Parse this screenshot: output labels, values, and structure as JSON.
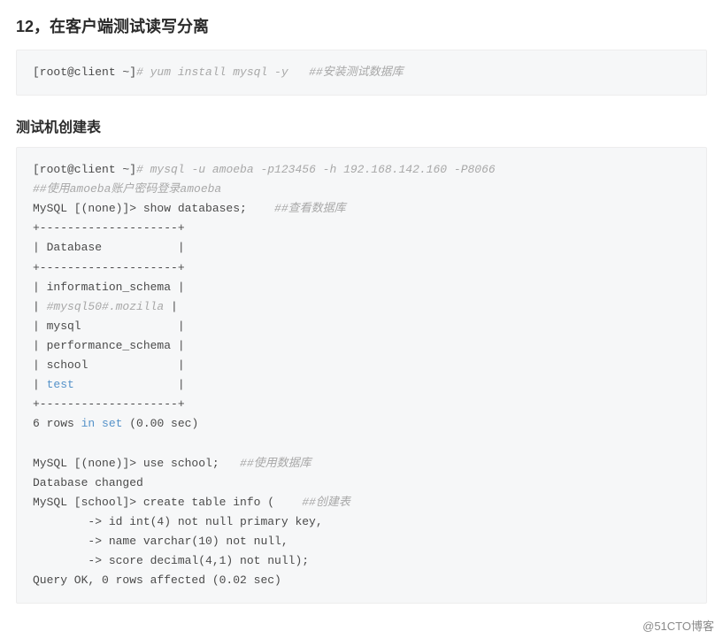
{
  "heading_main": "12，在客户端测试读写分离",
  "code1": {
    "prompt": "[root@client ~]",
    "cmd_comment": "# yum install mysql -y   ",
    "cn_comment": "##安装测试数据库"
  },
  "heading_sub": "测试机创建表",
  "code2": {
    "l1_prompt": "[root@client ~]",
    "l1_cmt": "# mysql -u amoeba -p123456 -h 192.168.142.160 -P8066",
    "l2_cmt": "##使用amoeba账户密码登录amoeba",
    "l3_a": "MySQL [(none)]> show databases;    ",
    "l3_cmt": "##查看数据库",
    "l4": "+--------------------+",
    "l5": "| Database           |",
    "l6": "+--------------------+",
    "l7": "| information_schema |",
    "l8_a": "| ",
    "l8_cmt": "#mysql50#.mozilla",
    "l8_b": " |",
    "l9": "| mysql              |",
    "l10": "| performance_schema |",
    "l11": "| school             |",
    "l12_a": "| ",
    "l12_kw": "test",
    "l12_b": "               |",
    "l13": "+--------------------+",
    "l14_a": "6 rows ",
    "l14_kw1": "in",
    "l14_b": " ",
    "l14_kw2": "set",
    "l14_c": " (0.00 sec)",
    "l15": "",
    "l16_a": "MySQL [(none)]> use school;   ",
    "l16_cmt": "##使用数据库",
    "l17": "Database changed",
    "l18_a": "MySQL [school]> create table info (    ",
    "l18_cmt": "##创建表",
    "l19": "        -> id int(4) not null primary key,",
    "l20": "        -> name varchar(10) not null,",
    "l21": "        -> score decimal(4,1) not null);",
    "l22": "Query OK, 0 rows affected (0.02 sec)"
  },
  "watermark": "@51CTO博客"
}
